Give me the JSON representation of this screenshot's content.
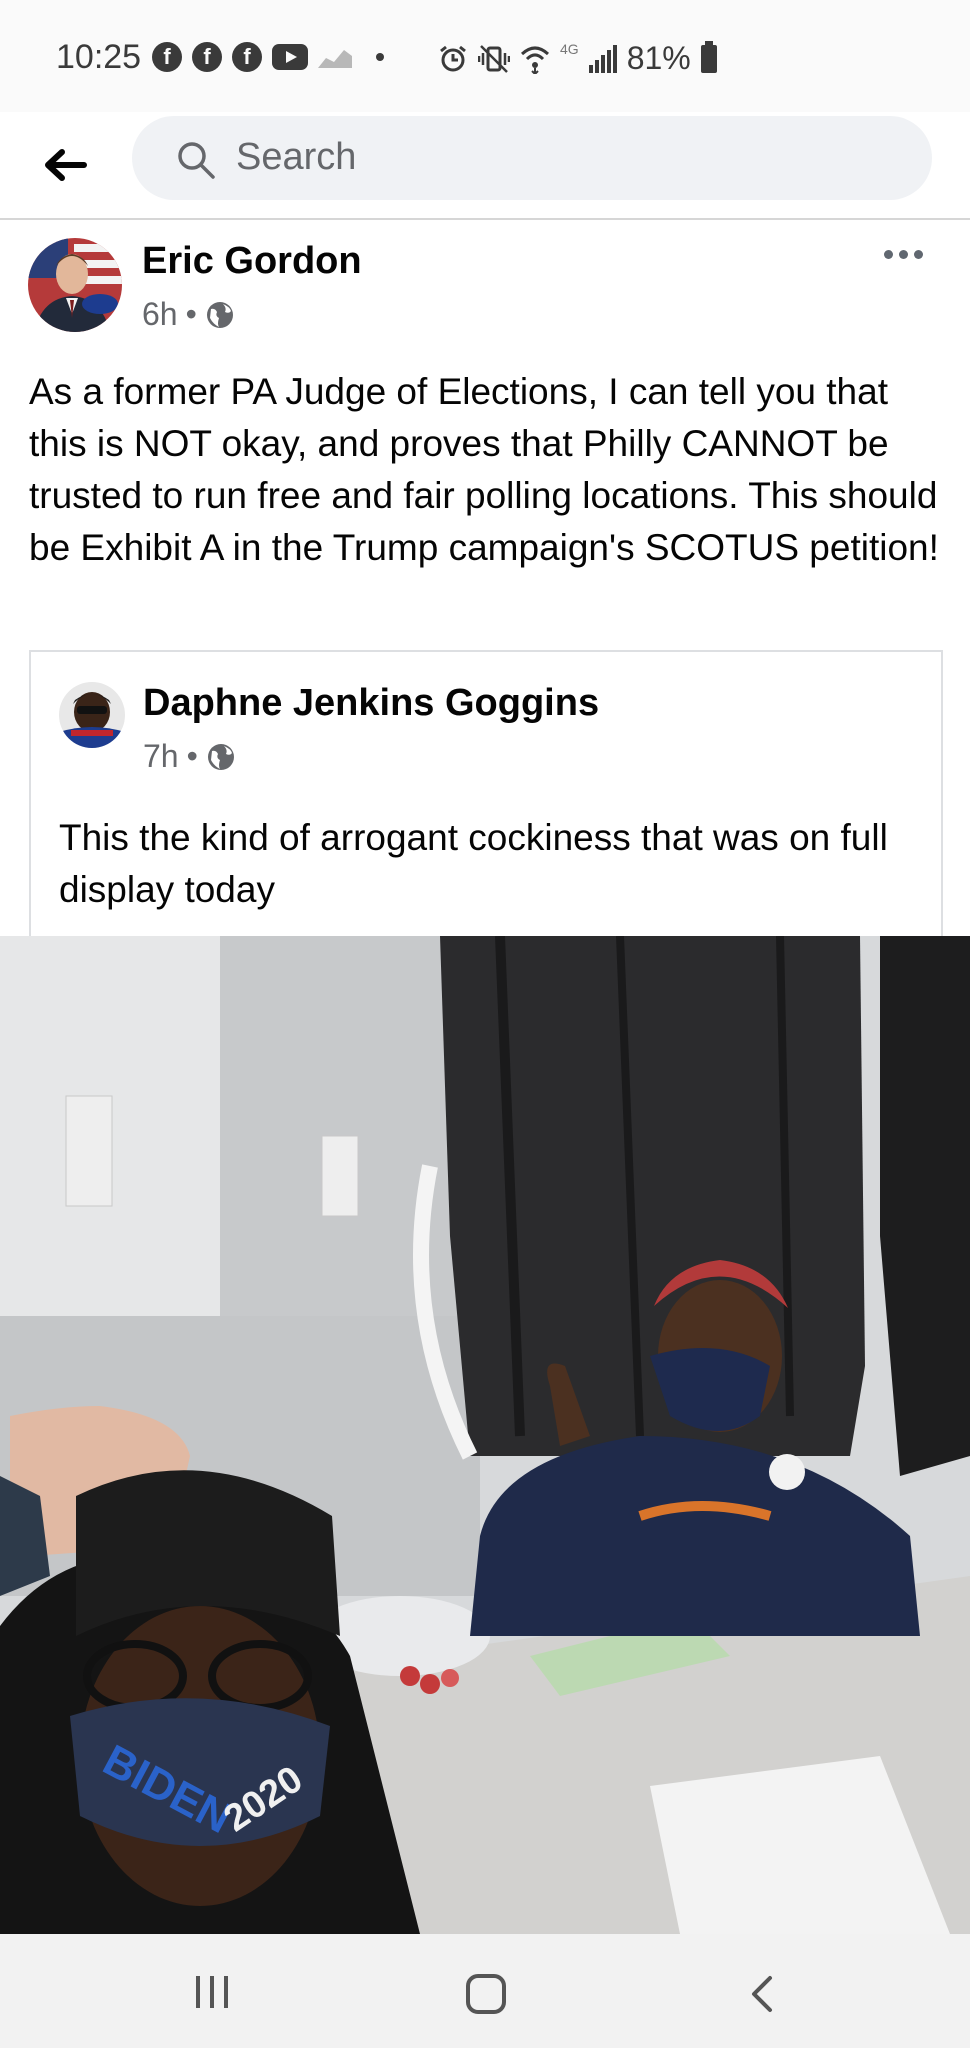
{
  "status_bar": {
    "time": "10:25",
    "network_label": "4G",
    "battery": "81%",
    "notification_icons": [
      "facebook-icon",
      "facebook-icon",
      "facebook-icon",
      "youtube-icon",
      "chart-icon",
      "dot-icon"
    ],
    "system_icons": [
      "alarm-icon",
      "vibrate-icon",
      "wifi-icon",
      "signal-icon",
      "battery-icon"
    ]
  },
  "header": {
    "search_placeholder": "Search"
  },
  "post": {
    "author": "Eric Gordon",
    "time": "6h",
    "separator": "•",
    "audience_icon": "globe-icon",
    "text": "As a former PA Judge of Elections, I can tell you that this is NOT okay, and proves that Philly CANNOT be trusted to run free and fair polling locations.  This should be Exhibit A in the Trump campaign's SCOTUS petition!",
    "shared": {
      "author": "Daphne Jenkins Goggins",
      "time": "7h",
      "separator": "•",
      "text": "This the kind of arrogant cockiness that was on full display today",
      "photo_mask_text_1": "BIDEN",
      "photo_mask_text_2": "2020"
    }
  },
  "nav_bar": {
    "items": [
      "recents-icon",
      "home-icon",
      "back-icon"
    ]
  },
  "colors": {
    "primary_text": "#050505",
    "secondary_text": "#65676b",
    "search_bg": "#f0f2f5",
    "card_border": "#dddfe2"
  }
}
